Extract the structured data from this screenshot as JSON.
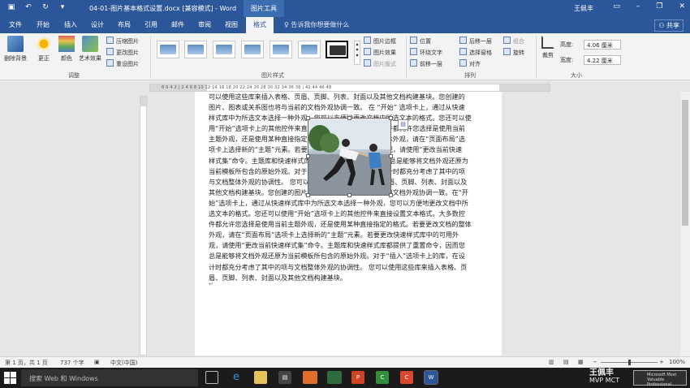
{
  "titlebar": {
    "doc_title": "04-01-图片基本格式设置.docx [兼容模式] - Word",
    "tools_tab": "图片工具",
    "user": "王佩丰",
    "quick_access": [
      "save-icon",
      "undo-icon",
      "redo-icon",
      "customize-icon"
    ]
  },
  "ribbon_tabs": {
    "tabs": [
      "文件",
      "开始",
      "插入",
      "设计",
      "布局",
      "引用",
      "邮件",
      "审阅",
      "视图",
      "格式"
    ],
    "active": "格式",
    "tell_me": "告诉我你想要做什么",
    "share": "共享"
  },
  "ribbon": {
    "adjust": {
      "remove_bg": "删除背景",
      "corrections": "更正",
      "color": "颜色",
      "artistic": "艺术效果",
      "compress": "压缩图片",
      "change": "更改图片",
      "reset": "重设图片",
      "label": "调整"
    },
    "styles": {
      "border": "图片边框",
      "effects": "图片效果",
      "layout": "图片版式",
      "label": "图片样式"
    },
    "arrange": {
      "position": "位置",
      "wrap": "环绕文字",
      "bring_forward": "前移一层",
      "send_backward": "后移一层",
      "selection_pane": "选择窗格",
      "align": "对齐",
      "group": "组合",
      "rotate": "旋转",
      "label": "排列"
    },
    "size": {
      "crop": "裁剪",
      "height_label": "高度:",
      "height_value": "4.06 厘米",
      "width_label": "宽度:",
      "width_value": "4.22 厘米",
      "label": "大小"
    }
  },
  "ruler_numbers": "8  6  4  2  |  2  4  6  8  10  12  14  16  18  20  22  24  26  28  30  32  34  36  38  |  42  44  46  48",
  "document": {
    "lines": [
      "可以使用这些库来插入表格、页眉、页脚、列表、封面以及其他文档构建基块。您创建的",
      "图片、图表或关系图也将与当前的文档外观协调一致。 在 “开始” 选项卡上，通过从快速",
      "样式库中为所选文本选择一种外观，您可以方便地更改文档中所选文本的格式。您还可以使",
      "用“开始”选项卡上的其他控件来直接设置文本格式。大多数控件都允许您选择是使用当前",
      "主题外观，还是使用某种直接指定的格式。若要更改文档的整体外观，请在“页面布局”选",
      "项卡上选择新的“主题”元素。若要更改快速样式库中的可用外观，请使用“更改当前快速",
      "样式集”命令。主题库和快速样式库都提供了重置命令，因而您总是能够将文档外观还原为",
      "当前模板所包含的原始外观。对于“插入”选项卡上的库，在设计时都充分考虑了其中的项",
      "与文档整体外观的协调性。 您可以使用这些库来插入表格、页眉、页脚、列表、封面以及",
      "其他文档构建基块。您创建的图片、图表或关系图也将与当前的文档外观协调一致。在“开",
      "始”选项卡上，通过从快速样式库中为所选文本选择一种外观，您可以方便地更改文档中所",
      "选文本的格式。您还可以使用“开始”选项卡上的其他控件来直接设置文本格式。大多数控",
      "件都允许您选择是使用当前主题外观，还是使用某种直接指定的格式。若要更改文档的整体",
      "外观，请在“页面布局”选项卡上选择新的“主题”元素。若要更改快速样式库中的可用外",
      "观，请使用“更改当前快速样式集”命令。主题库和快速样式库都提供了重置命令，因而您",
      "总是能够将文档外观还原为当前模板所包含的原始外观。对于“插入”选项卡上的库，在设",
      "计时都充分考虑了其中的项与文档整体外观的协调性。 您可以使用这些库来插入表格、页",
      "眉、页脚、列表、封面以及其他文档构建基块。"
    ]
  },
  "statusbar": {
    "page": "第 1 页，共 1 页",
    "words": "737 个字",
    "language": "中文(中国)",
    "zoom": "100%"
  },
  "taskbar": {
    "search": "搜索 Web 和 Windows",
    "brand_name": "王佩丰",
    "brand_title": "MVP MCT",
    "mvp_badge": "Microsoft Most Valuable Professional"
  }
}
